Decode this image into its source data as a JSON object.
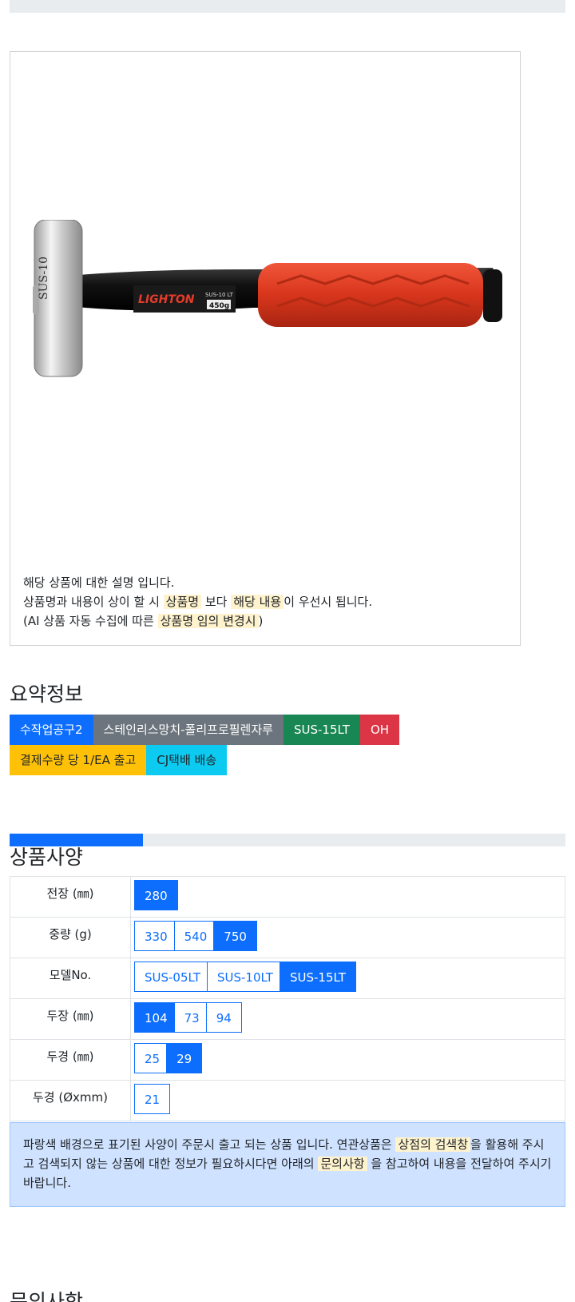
{
  "description": {
    "line1": "해당 상품에 대한 설명 입니다.",
    "line2_a": "상품명과 내용이 상이 할 시",
    "line2_hl1": "상품명",
    "line2_b": "보다",
    "line2_hl2": "해당 내용",
    "line2_c": "이 우선시 됩니다.",
    "line3_a": "(AI 상품 자동 수집에 따른",
    "line3_hl": "상품명 임의 변경시",
    "line3_b": ")"
  },
  "summary": {
    "title": "요약정보",
    "badges_row1": [
      {
        "label": "수작업공구2",
        "color": "#0d6efd"
      },
      {
        "label": "스테인리스망치-폴리프로필렌자루",
        "color": "#6c757d"
      },
      {
        "label": "SUS-15LT",
        "color": "#198754"
      },
      {
        "label": "OH",
        "color": "#dc3545"
      }
    ],
    "badges_row2": [
      {
        "label": "결제수량 당 1/EA 출고",
        "color": "#ffc107"
      },
      {
        "label": "CJ택배 배송",
        "color": "#0dcaf0"
      }
    ]
  },
  "progress": {
    "value_percent": 24
  },
  "spec": {
    "title": "상품사양",
    "rows": [
      {
        "label": "전장 (㎜)",
        "options": [
          {
            "label": "280",
            "selected": true
          }
        ]
      },
      {
        "label": "중량 (g)",
        "options": [
          {
            "label": "330",
            "selected": false
          },
          {
            "label": "540",
            "selected": false
          },
          {
            "label": "750",
            "selected": true
          }
        ]
      },
      {
        "label": "모델No.",
        "options": [
          {
            "label": "SUS-05LT",
            "selected": false
          },
          {
            "label": "SUS-10LT",
            "selected": false
          },
          {
            "label": "SUS-15LT",
            "selected": true
          }
        ]
      },
      {
        "label": "두장 (㎜)",
        "options": [
          {
            "label": "104",
            "selected": true
          },
          {
            "label": "73",
            "selected": false
          },
          {
            "label": "94",
            "selected": false
          }
        ]
      },
      {
        "label": "두경 (㎜)",
        "options": [
          {
            "label": "25",
            "selected": false
          },
          {
            "label": "29",
            "selected": true
          }
        ]
      },
      {
        "label": "두경 (Øxmm)",
        "options": [
          {
            "label": "21",
            "selected": false
          }
        ]
      }
    ]
  },
  "notice": {
    "a": "파랑색 배경으로 표기된 사양이 주문시 출고 되는 상품 입니다. 연관상품은",
    "hl1": "상점의 검색창",
    "b": "을 활용해 주시고 검색되지 않는 상품에 대한 정보가 필요하시다면 아래의",
    "hl2": "문의사항",
    "c": "을 참고하여 내용을 전달하여 주시기 바랍니다."
  },
  "inquiry": {
    "title": "문의사항"
  },
  "product_image": {
    "brand_text": "LIGHTON",
    "head_text": "SUS-10",
    "weight_text": "450g",
    "model_text": "SUS-10 LT"
  }
}
